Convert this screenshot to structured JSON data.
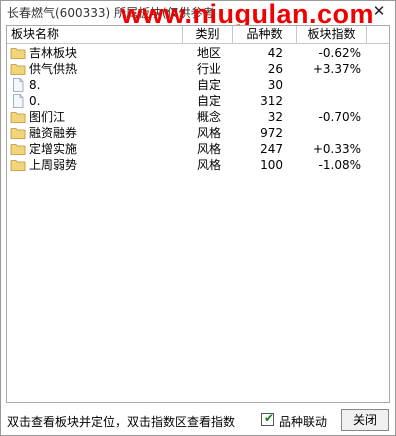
{
  "window": {
    "title": "长春燃气(600333)  所属板块(仅供参考",
    "watermark": "www.niugulan.com",
    "close_glyph": "✕"
  },
  "table": {
    "columns": [
      "板块名称",
      "类别",
      "品种数",
      "板块指数"
    ],
    "rows": [
      {
        "icon": "folder-icon",
        "name": "吉林板块",
        "category": "地区",
        "count": "42",
        "index": "-0.62%"
      },
      {
        "icon": "folder-icon",
        "name": "供气供热",
        "category": "行业",
        "count": "26",
        "index": "+3.37%"
      },
      {
        "icon": "document-icon",
        "name": "8.",
        "category": "自定",
        "count": "30",
        "index": ""
      },
      {
        "icon": "document-icon",
        "name": "0.",
        "category": "自定",
        "count": "312",
        "index": ""
      },
      {
        "icon": "folder-icon",
        "name": "图们江",
        "category": "概念",
        "count": "32",
        "index": "-0.70%"
      },
      {
        "icon": "folder-icon",
        "name": "融资融券",
        "category": "风格",
        "count": "972",
        "index": ""
      },
      {
        "icon": "folder-icon",
        "name": "定增实施",
        "category": "风格",
        "count": "247",
        "index": "+0.33%"
      },
      {
        "icon": "folder-icon",
        "name": "上周弱势",
        "category": "风格",
        "count": "100",
        "index": "-1.08%"
      }
    ]
  },
  "status": {
    "hint": "双击查看板块并定位，双击指数区查看指数",
    "checkbox_label": "品种联动",
    "checkbox_checked": true,
    "close_button": "关闭"
  },
  "colors": {
    "watermark": "#f00000",
    "folder": "#f2d57a",
    "checkmark": "#1a7a1a"
  }
}
